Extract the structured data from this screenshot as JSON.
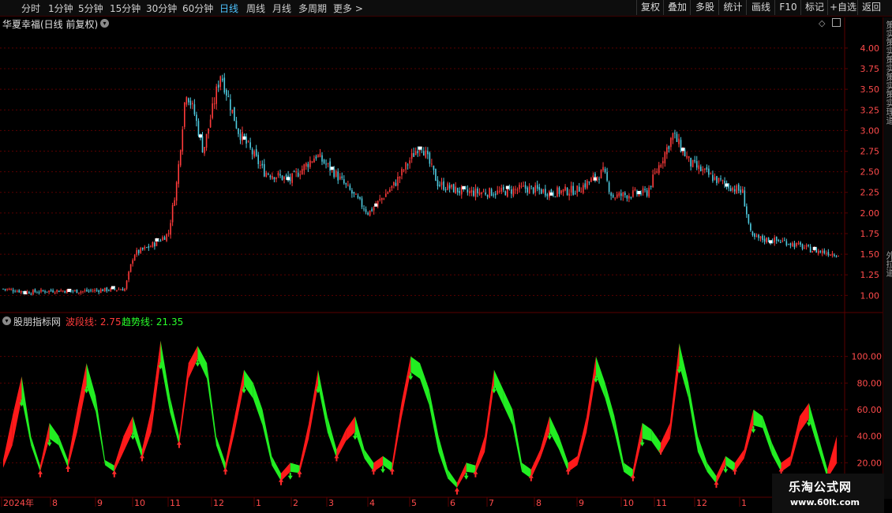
{
  "toolbar": {
    "periods": [
      "分时",
      "1分钟",
      "5分钟",
      "15分钟",
      "30分钟",
      "60分钟",
      "日线",
      "周线",
      "月线",
      "多周期",
      "更多 >"
    ],
    "active_period": "日线",
    "right_buttons": [
      "复权",
      "叠加",
      "多股",
      "统计",
      "画线",
      "F10",
      "标记",
      "+自选",
      "返回"
    ]
  },
  "stock": {
    "title": "华夏幸福(日线 前复权)"
  },
  "indicator": {
    "name": "股朋指标网",
    "wave_label": "波段线: 2.75",
    "trend_label": "趋势线: 21.35"
  },
  "side_panel": {
    "text_top": "策实策实策实策实策实理道",
    "text_bottom": "外拉道"
  },
  "watermark": {
    "line1": "乐淘公式网",
    "line2": "www.60lt.com"
  },
  "colors": {
    "up": "#ff3b3b",
    "down": "#4ecbe0",
    "wave": "#ff1a1a",
    "trend": "#22ee22",
    "grid": "#5a0000",
    "axis_text": "#ff4b4b"
  },
  "chart_data": [
    {
      "type": "candlestick",
      "title": "华夏幸福(日线 前复权)",
      "ylim": [
        0.85,
        4.2
      ],
      "yticks": [
        1.0,
        1.25,
        1.5,
        1.75,
        2.0,
        2.25,
        2.5,
        2.75,
        3.0,
        3.25,
        3.5,
        3.75,
        4.0
      ],
      "grid": true,
      "close_path": [
        [
          0,
          1.08
        ],
        [
          0.03,
          1.04
        ],
        [
          0.06,
          1.06
        ],
        [
          0.09,
          1.05
        ],
        [
          0.12,
          1.07
        ],
        [
          0.14,
          1.08
        ],
        [
          0.15,
          1.5
        ],
        [
          0.17,
          1.6
        ],
        [
          0.19,
          1.75
        ],
        [
          0.2,
          2.4
        ],
        [
          0.21,
          3.5
        ],
        [
          0.22,
          3.2
        ],
        [
          0.23,
          2.75
        ],
        [
          0.25,
          3.7
        ],
        [
          0.27,
          3.0
        ],
        [
          0.3,
          2.5
        ],
        [
          0.33,
          2.4
        ],
        [
          0.36,
          2.7
        ],
        [
          0.38,
          2.5
        ],
        [
          0.42,
          2.0
        ],
        [
          0.45,
          2.35
        ],
        [
          0.48,
          2.85
        ],
        [
          0.5,
          2.35
        ],
        [
          0.53,
          2.25
        ],
        [
          0.57,
          2.25
        ],
        [
          0.6,
          2.3
        ],
        [
          0.63,
          2.25
        ],
        [
          0.66,
          2.28
        ],
        [
          0.69,
          2.5
        ],
        [
          0.7,
          2.2
        ],
        [
          0.74,
          2.25
        ],
        [
          0.77,
          2.95
        ],
        [
          0.79,
          2.6
        ],
        [
          0.82,
          2.4
        ],
        [
          0.85,
          2.25
        ],
        [
          0.86,
          1.7
        ],
        [
          0.9,
          1.65
        ],
        [
          0.93,
          1.55
        ],
        [
          0.96,
          1.5
        ]
      ],
      "xlabels": [
        "2024年",
        "8",
        "9",
        "10",
        "11",
        "12",
        "1",
        "2",
        "3",
        "4",
        "5",
        "6",
        "7",
        "8",
        "9",
        "10",
        "11",
        "12",
        "1"
      ]
    },
    {
      "type": "line",
      "title": "股朋指标网",
      "ylim": [
        0,
        120
      ],
      "yticks": [
        20.0,
        40.0,
        60.0,
        80.0,
        100.0
      ],
      "grid": true,
      "series": [
        {
          "name": "波段线",
          "values": [
            22,
            55,
            85,
            40,
            18,
            50,
            40,
            22,
            60,
            95,
            70,
            22,
            18,
            40,
            55,
            30,
            60,
            112,
            70,
            40,
            95,
            108,
            95,
            40,
            20,
            55,
            90,
            80,
            60,
            25,
            12,
            20,
            18,
            50,
            90,
            55,
            30,
            45,
            55,
            30,
            20,
            25,
            20,
            65,
            100,
            95,
            75,
            40,
            15,
            5,
            20,
            18,
            40,
            90,
            75,
            60,
            20,
            15,
            30,
            55,
            40,
            20,
            25,
            55,
            100,
            80,
            55,
            20,
            15,
            50,
            45,
            35,
            50,
            110,
            80,
            40,
            20,
            10,
            25,
            20,
            30,
            60,
            55,
            35,
            20,
            25,
            55,
            65,
            40,
            15,
            40
          ]
        },
        {
          "name": "趋势线",
          "values": [
            18,
            35,
            70,
            35,
            15,
            40,
            35,
            18,
            45,
            80,
            60,
            20,
            15,
            30,
            45,
            25,
            45,
            98,
            60,
            35,
            85,
            100,
            85,
            35,
            15,
            45,
            80,
            70,
            50,
            20,
            8,
            15,
            14,
            40,
            80,
            45,
            25,
            38,
            45,
            25,
            15,
            20,
            15,
            55,
            90,
            85,
            65,
            30,
            10,
            3,
            15,
            14,
            30,
            80,
            65,
            50,
            15,
            10,
            25,
            45,
            32,
            15,
            20,
            45,
            88,
            70,
            45,
            15,
            10,
            40,
            38,
            28,
            40,
            95,
            70,
            30,
            15,
            6,
            20,
            15,
            25,
            50,
            48,
            28,
            15,
            20,
            45,
            55,
            32,
            10,
            21.35
          ]
        }
      ]
    }
  ]
}
